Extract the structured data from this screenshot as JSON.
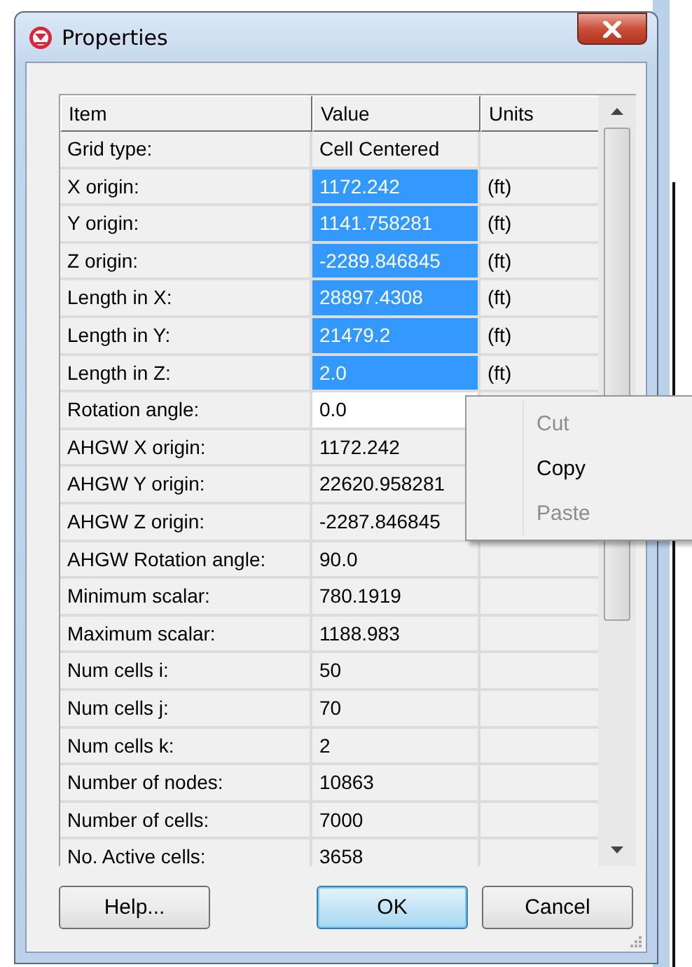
{
  "window": {
    "title": "Properties"
  },
  "table": {
    "columns": [
      "Item",
      "Value",
      "Units"
    ],
    "rows": [
      {
        "item": "Grid type:",
        "value": "Cell Centered",
        "units": "",
        "selected": false,
        "editing": false
      },
      {
        "item": "X origin:",
        "value": "1172.242",
        "units": "(ft)",
        "selected": true,
        "editing": false
      },
      {
        "item": "Y origin:",
        "value": "1141.758281",
        "units": "(ft)",
        "selected": true,
        "editing": false
      },
      {
        "item": "Z origin:",
        "value": "-2289.846845",
        "units": "(ft)",
        "selected": true,
        "editing": false
      },
      {
        "item": "Length in X:",
        "value": "28897.4308",
        "units": "(ft)",
        "selected": true,
        "editing": false
      },
      {
        "item": "Length in Y:",
        "value": "21479.2",
        "units": "(ft)",
        "selected": true,
        "editing": false
      },
      {
        "item": "Length in Z:",
        "value": "2.0",
        "units": "(ft)",
        "selected": true,
        "editing": false
      },
      {
        "item": "Rotation angle:",
        "value": "0.0",
        "units": "",
        "selected": false,
        "editing": true
      },
      {
        "item": "AHGW X origin:",
        "value": "1172.242",
        "units": "",
        "selected": false,
        "editing": false
      },
      {
        "item": "AHGW Y origin:",
        "value": "22620.958281",
        "units": "",
        "selected": false,
        "editing": false
      },
      {
        "item": "AHGW Z origin:",
        "value": "-2287.846845",
        "units": "",
        "selected": false,
        "editing": false
      },
      {
        "item": "AHGW Rotation angle:",
        "value": "90.0",
        "units": "",
        "selected": false,
        "editing": false
      },
      {
        "item": "Minimum scalar:",
        "value": "780.1919",
        "units": "",
        "selected": false,
        "editing": false
      },
      {
        "item": "Maximum scalar:",
        "value": "1188.983",
        "units": "",
        "selected": false,
        "editing": false
      },
      {
        "item": "Num cells i:",
        "value": "50",
        "units": "",
        "selected": false,
        "editing": false
      },
      {
        "item": "Num cells j:",
        "value": "70",
        "units": "",
        "selected": false,
        "editing": false
      },
      {
        "item": "Num cells k:",
        "value": "2",
        "units": "",
        "selected": false,
        "editing": false
      },
      {
        "item": "Number of nodes:",
        "value": "10863",
        "units": "",
        "selected": false,
        "editing": false
      },
      {
        "item": "Number of cells:",
        "value": "7000",
        "units": "",
        "selected": false,
        "editing": false
      },
      {
        "item": "No. Active cells:",
        "value": "3658",
        "units": "",
        "selected": false,
        "editing": false
      }
    ]
  },
  "context_menu": [
    {
      "label": "Cut",
      "disabled": true
    },
    {
      "label": "Copy",
      "disabled": false
    },
    {
      "label": "Paste",
      "disabled": true
    }
  ],
  "buttons": [
    {
      "label": "Help...",
      "default": false
    },
    {
      "label": "OK",
      "default": true
    },
    {
      "label": "Cancel",
      "default": false
    }
  ]
}
